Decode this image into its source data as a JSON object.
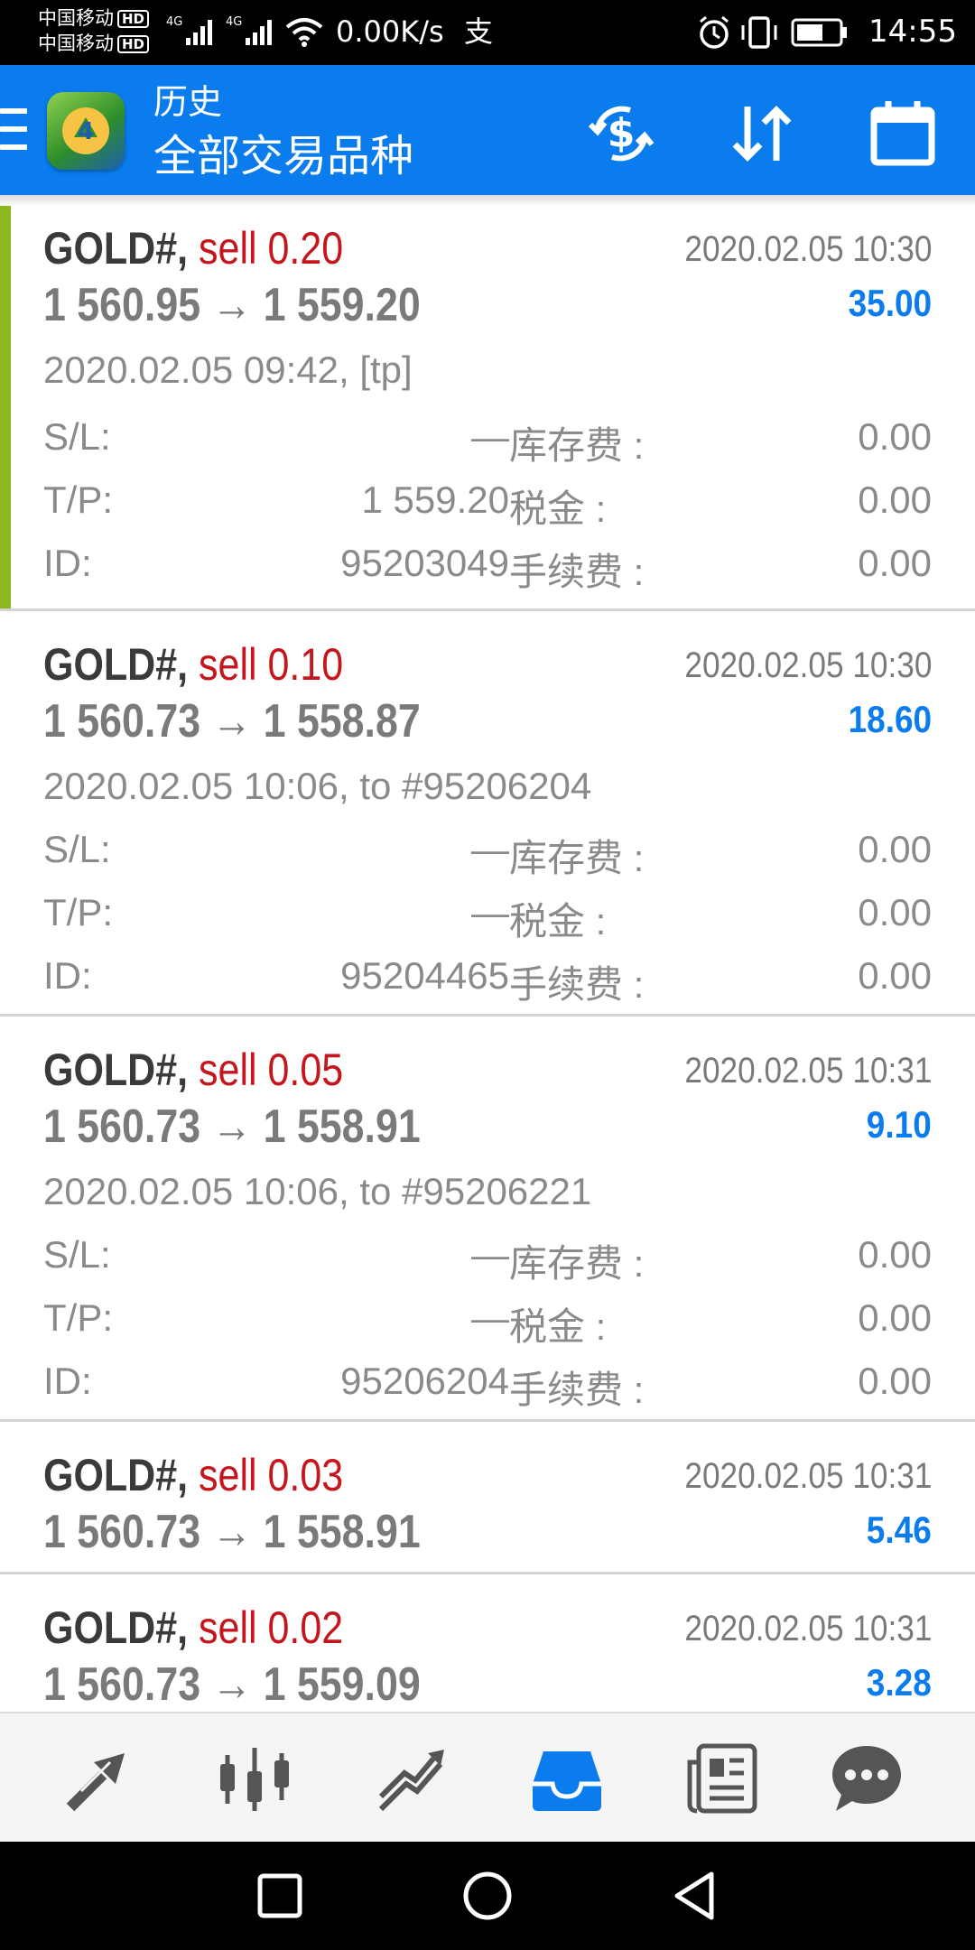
{
  "status_bar": {
    "carrier1": "中国移动",
    "carrier2": "中国移动",
    "hd_badge": "HD",
    "network": "4G",
    "speed": "0.00K/s",
    "pay_icon": "支",
    "time": "14:55"
  },
  "app_bar": {
    "title": "历史",
    "subtitle": "全部交易品种"
  },
  "trades": [
    {
      "symbol": "GOLD#,",
      "side": "sell 0.20",
      "close_time": "2020.02.05 10:30",
      "prices": "1 560.95 → 1 559.20",
      "profit": "35.00",
      "open_info": "2020.02.05 09:42, [tp]",
      "sl_label": "S/L:",
      "sl_value": "—",
      "tp_label": "T/P:",
      "tp_value": "1 559.20",
      "id_label": "ID:",
      "id_value": "95203049",
      "swap_label": "库存费 :",
      "swap_value": "0.00",
      "tax_label": "税金 :",
      "tax_value": "0.00",
      "fee_label": "手续费 :",
      "fee_value": "0.00"
    },
    {
      "symbol": "GOLD#,",
      "side": "sell 0.10",
      "close_time": "2020.02.05 10:30",
      "prices": "1 560.73 → 1 558.87",
      "profit": "18.60",
      "open_info": "2020.02.05 10:06, to #95206204",
      "sl_label": "S/L:",
      "sl_value": "—",
      "tp_label": "T/P:",
      "tp_value": "—",
      "id_label": "ID:",
      "id_value": "95204465",
      "swap_label": "库存费 :",
      "swap_value": "0.00",
      "tax_label": "税金 :",
      "tax_value": "0.00",
      "fee_label": "手续费 :",
      "fee_value": "0.00"
    },
    {
      "symbol": "GOLD#,",
      "side": "sell 0.05",
      "close_time": "2020.02.05 10:31",
      "prices": "1 560.73 → 1 558.91",
      "profit": "9.10",
      "open_info": "2020.02.05 10:06, to #95206221",
      "sl_label": "S/L:",
      "sl_value": "—",
      "tp_label": "T/P:",
      "tp_value": "—",
      "id_label": "ID:",
      "id_value": "95206204",
      "swap_label": "库存费 :",
      "swap_value": "0.00",
      "tax_label": "税金 :",
      "tax_value": "0.00",
      "fee_label": "手续费 :",
      "fee_value": "0.00"
    },
    {
      "symbol": "GOLD#,",
      "side": "sell 0.03",
      "close_time": "2020.02.05 10:31",
      "prices": "1 560.73 → 1 558.91",
      "profit": "5.46"
    },
    {
      "symbol": "GOLD#,",
      "side": "sell 0.02",
      "close_time": "2020.02.05 10:31",
      "prices": "1 560.73 → 1 559.09",
      "profit": "3.28"
    }
  ],
  "colors": {
    "brand_blue": "#0a7cee",
    "sell_red": "#c4161c",
    "accent_green": "#8ab81e"
  },
  "bottom_nav_icons": [
    "quotes-icon",
    "chart-icon",
    "trade-icon",
    "history-icon",
    "news-icon",
    "chat-icon"
  ],
  "active_nav": "history-icon"
}
